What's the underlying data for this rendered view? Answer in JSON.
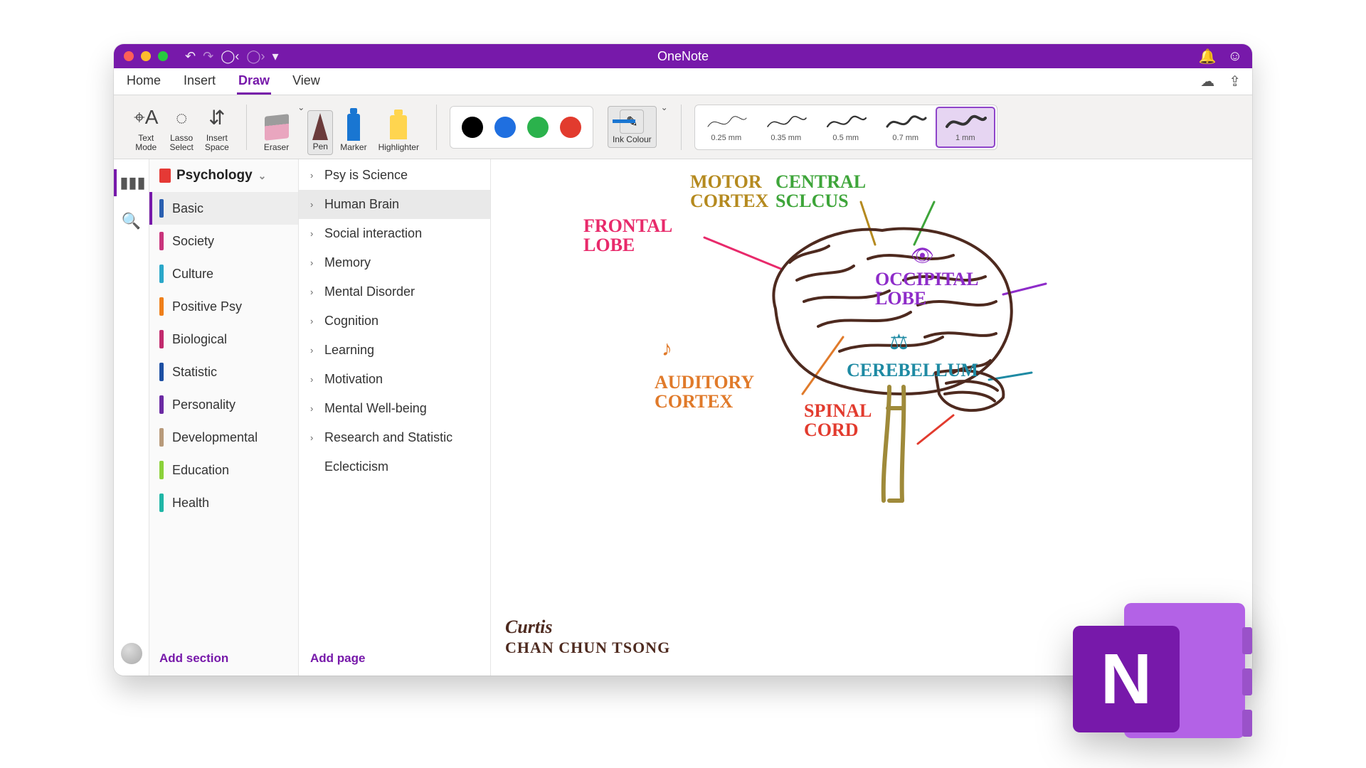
{
  "app": {
    "title": "OneNote",
    "badge_letter": "N"
  },
  "tabs": {
    "items": [
      "Home",
      "Insert",
      "Draw",
      "View"
    ],
    "active": "Draw"
  },
  "ribbon": {
    "text_mode": "Text\nMode",
    "lasso": "Lasso\nSelect",
    "insert_space": "Insert\nSpace",
    "tools": {
      "eraser": "Eraser",
      "pen": "Pen",
      "marker": "Marker",
      "highlighter": "Highlighter"
    },
    "ink_colour": "Ink\nColour",
    "swatches": [
      "#000000",
      "#1f6fe0",
      "#2bb24c",
      "#e23b2e"
    ],
    "thickness": [
      {
        "label": "0.25 mm",
        "w": 1
      },
      {
        "label": "0.35 mm",
        "w": 1.6
      },
      {
        "label": "0.5 mm",
        "w": 2.2
      },
      {
        "label": "0.7 mm",
        "w": 3
      },
      {
        "label": "1 mm",
        "w": 4
      }
    ],
    "thickness_selected": 4
  },
  "notebook": {
    "name": "Psychology"
  },
  "sections": [
    {
      "label": "Basic",
      "color": "#2a5fb0",
      "selected": true
    },
    {
      "label": "Society",
      "color": "#c9347c"
    },
    {
      "label": "Culture",
      "color": "#2aa7c9"
    },
    {
      "label": "Positive Psy",
      "color": "#ef7f1a"
    },
    {
      "label": "Biological",
      "color": "#c12a6d"
    },
    {
      "label": "Statistic",
      "color": "#1d4fa3"
    },
    {
      "label": "Personality",
      "color": "#6b2aa3"
    },
    {
      "label": "Developmental",
      "color": "#b89a7a"
    },
    {
      "label": "Education",
      "color": "#8bd13a"
    },
    {
      "label": "Health",
      "color": "#1fb6a6"
    }
  ],
  "add_section": "Add section",
  "pages": [
    {
      "label": "Psy is Science",
      "expandable": true
    },
    {
      "label": "Human Brain",
      "expandable": true,
      "selected": true
    },
    {
      "label": "Social interaction",
      "expandable": true
    },
    {
      "label": "Memory",
      "expandable": true
    },
    {
      "label": "Mental Disorder",
      "expandable": true
    },
    {
      "label": "Cognition",
      "expandable": true
    },
    {
      "label": "Learning",
      "expandable": true
    },
    {
      "label": "Motivation",
      "expandable": true
    },
    {
      "label": "Mental Well-being",
      "expandable": true
    },
    {
      "label": "Research and Statistic",
      "expandable": true
    },
    {
      "label": "Eclecticism",
      "expandable": false
    }
  ],
  "add_page": "Add page",
  "canvas": {
    "signature_script": "Curtis",
    "signature_caps": "CHAN CHUN TSONG",
    "labels": {
      "frontal": "FRONTAL\nLOBE",
      "motor": "MOTOR\nCORTEX",
      "central": "CENTRAL\nSCLCUS",
      "occipital": "OCCIPITAL\nLOBE",
      "cerebellum": "CEREBELLUM",
      "spinal": "SPINAL\nCORD",
      "auditory": "AUDITORY\nCORTEX"
    },
    "colors": {
      "frontal": "#e82a6b",
      "motor": "#b58a1f",
      "central": "#3ea53a",
      "occipital": "#8e2cc9",
      "cerebellum": "#1e8aa3",
      "spinal": "#e23b2e",
      "auditory": "#e07a2a",
      "brain_outline": "#4e2a1f",
      "stem": "#9f8a3a"
    }
  }
}
